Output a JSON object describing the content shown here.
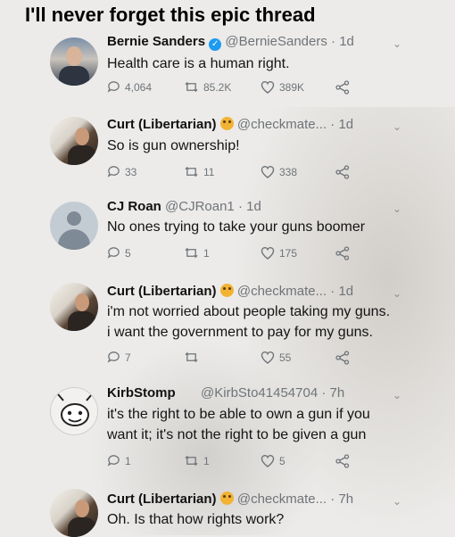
{
  "caption": "I'll never forget this epic thread",
  "tweets": [
    {
      "name": "Bernie Sanders",
      "handle": "@BernieSanders",
      "time": "· 1d",
      "lines": [
        "Health care is a human right."
      ],
      "replies": "4,064",
      "retweets": "85.2K",
      "likes": "389K",
      "avatar": "bernie-avatar",
      "badge": "verified-badge-icon"
    },
    {
      "name": "Curt (Libertarian)",
      "handle": "@checkmate...",
      "time": "· 1d",
      "lines": [
        "So is gun ownership!"
      ],
      "replies": "33",
      "retweets": "11",
      "likes": "338",
      "avatar": "curt-avatar",
      "badge": "angry-emoji-icon"
    },
    {
      "name": "CJ Roan",
      "handle": "@CJRoan1",
      "time": "· 1d",
      "lines": [
        "No ones trying to take your guns boomer"
      ],
      "replies": "5",
      "retweets": "1",
      "likes": "175",
      "avatar": "default-avatar"
    },
    {
      "name": "Curt (Libertarian)",
      "handle": "@checkmate...",
      "time": "· 1d",
      "lines": [
        "i'm not worried about people taking my guns.",
        "i want the government to pay for my guns."
      ],
      "replies": "7",
      "retweets": "",
      "likes": "55",
      "avatar": "curt-avatar",
      "badge": "angry-emoji-icon"
    },
    {
      "name": "KirbStomp",
      "handle": "@KirbSto41454704",
      "time": "· 7h",
      "lines": [
        "it's the right to be able to own a gun if you",
        "want it; it's not the right to be given a gun"
      ],
      "replies": "1",
      "retweets": "1",
      "likes": "5",
      "avatar": "kirb-avatar"
    },
    {
      "name": "Curt (Libertarian)",
      "handle": "@checkmate...",
      "time": "· 7h",
      "lines": [
        "Oh. Is that how rights work?"
      ],
      "avatar": "curt-avatar",
      "badge": "angry-emoji-icon"
    }
  ]
}
